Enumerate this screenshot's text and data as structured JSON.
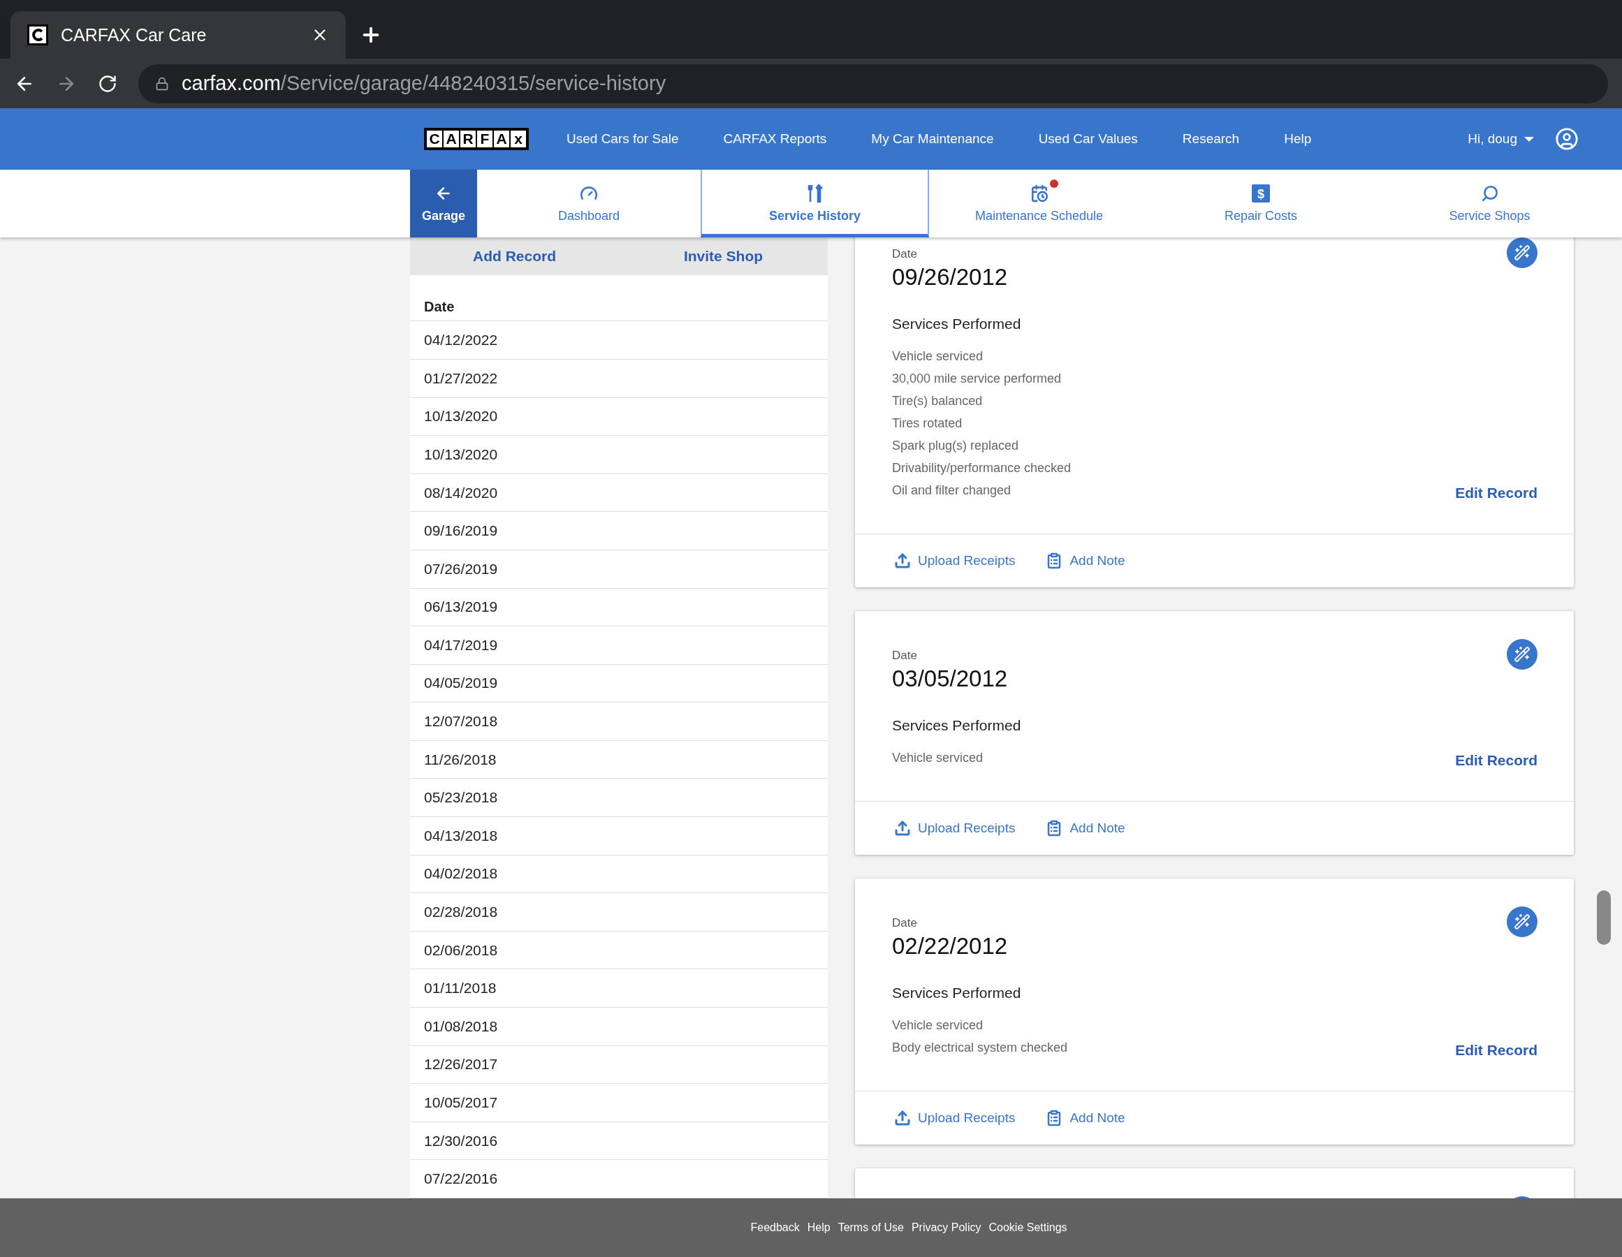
{
  "browser": {
    "tab_title": "CARFAX Car Care",
    "url_domain": "carfax.com",
    "url_path": "/Service/garage/448240315/service-history"
  },
  "nav": {
    "logo_letters": [
      "C",
      "A",
      "R",
      "F",
      "A",
      "x"
    ],
    "links": [
      "Used Cars for Sale",
      "CARFAX Reports",
      "My Car Maintenance",
      "Used Car Values",
      "Research",
      "Help"
    ],
    "user": "Hi, doug"
  },
  "subnav": [
    {
      "kind": "back",
      "label": "Garage",
      "selected": false,
      "notification": false
    },
    {
      "kind": "dashboard",
      "label": "Dashboard",
      "selected": false,
      "notification": false
    },
    {
      "kind": "history",
      "label": "Service History",
      "selected": true,
      "notification": false
    },
    {
      "kind": "schedule",
      "label": "Maintenance Schedule",
      "selected": false,
      "notification": true
    },
    {
      "kind": "costs",
      "label": "Repair Costs",
      "icon_glyph": "$",
      "selected": false,
      "notification": false
    },
    {
      "kind": "shops",
      "label": "Service Shops",
      "selected": false,
      "notification": false
    }
  ],
  "left_panel": {
    "actions": [
      "Add Record",
      "Invite Shop"
    ],
    "column": "Date",
    "rows": [
      "04/12/2022",
      "01/27/2022",
      "10/13/2020",
      "10/13/2020",
      "08/14/2020",
      "09/16/2019",
      "07/26/2019",
      "06/13/2019",
      "04/17/2019",
      "04/05/2019",
      "12/07/2018",
      "11/26/2018",
      "05/23/2018",
      "04/13/2018",
      "04/02/2018",
      "02/28/2018",
      "02/06/2018",
      "01/11/2018",
      "01/08/2018",
      "12/26/2017",
      "10/05/2017",
      "12/30/2016",
      "07/22/2016"
    ]
  },
  "records": [
    {
      "date_label": "Date",
      "date": "09/26/2012",
      "services_heading": "Services Performed",
      "services": [
        "Vehicle serviced",
        "30,000 mile service performed",
        "Tire(s) balanced",
        "Tires rotated",
        "Spark plug(s) replaced",
        "Drivability/performance checked",
        "Oil and filter changed"
      ],
      "edit": "Edit Record",
      "actions": [
        "Upload Receipts",
        "Add Note"
      ]
    },
    {
      "date_label": "Date",
      "date": "03/05/2012",
      "services_heading": "Services Performed",
      "services": [
        "Vehicle serviced"
      ],
      "edit": "Edit Record",
      "actions": [
        "Upload Receipts",
        "Add Note"
      ]
    },
    {
      "date_label": "Date",
      "date": "02/22/2012",
      "services_heading": "Services Performed",
      "services": [
        "Vehicle serviced",
        "Body electrical system checked"
      ],
      "edit": "Edit Record",
      "actions": [
        "Upload Receipts",
        "Add Note"
      ]
    }
  ],
  "more_records_below": true,
  "footer": [
    "Feedback",
    "Help",
    "Terms of Use",
    "Privacy Policy",
    "Cookie Settings"
  ]
}
